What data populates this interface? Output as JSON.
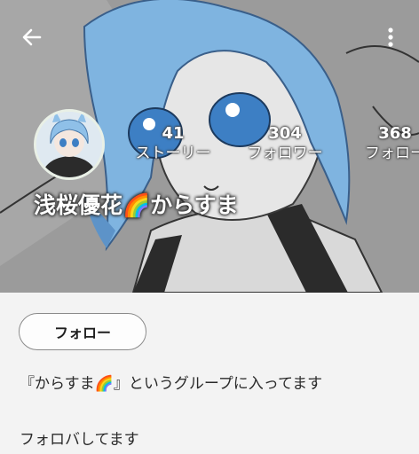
{
  "profile": {
    "username": "浅桜優花🌈からすま",
    "stats": {
      "stories": {
        "count": "41",
        "label": "ストーリー"
      },
      "followers": {
        "count": "304",
        "label": "フォロワー"
      },
      "following": {
        "count": "368",
        "label": "フォロー"
      }
    }
  },
  "actions": {
    "follow_label": "フォロー"
  },
  "info": {
    "group_text": "『からすま🌈』というグループに入ってます",
    "follows_you": "フォロバしてます"
  },
  "icons": {
    "back": "arrow-left",
    "more": "vertical-dots"
  },
  "colors": {
    "header_bg": "#9a9a9a",
    "page_bg": "#f3f3f3",
    "hair_blue": "#7fb4e0"
  }
}
